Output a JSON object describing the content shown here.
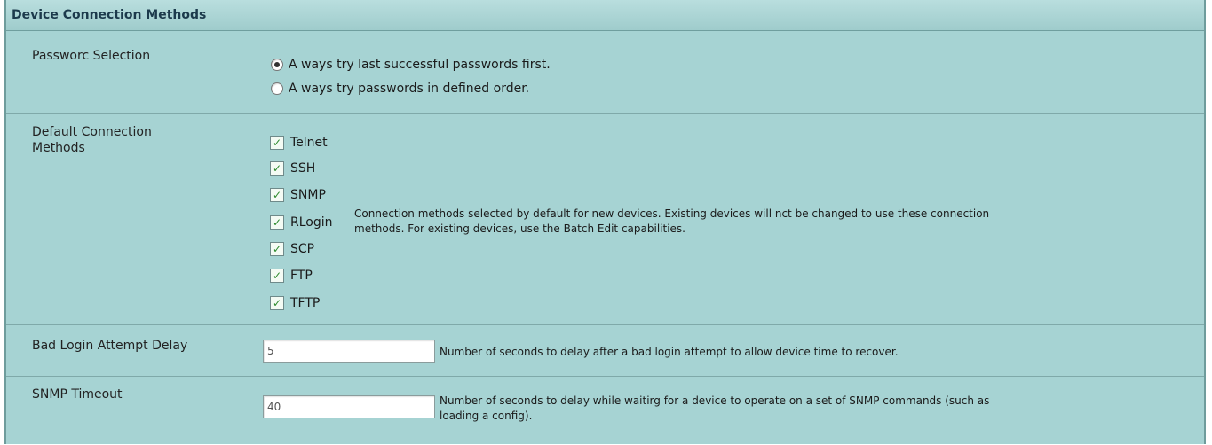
{
  "panel": {
    "title": "Device Connection Methods"
  },
  "password_selection": {
    "label": "Passworc Selection",
    "options": [
      {
        "label": "A ways try last successful passwords first.",
        "selected": true
      },
      {
        "label": "A ways try passwords in defined order.",
        "selected": false
      }
    ]
  },
  "connection_methods": {
    "label_line1": "Default Connection",
    "label_line2": "Methods",
    "methods": [
      {
        "label": "Telnet",
        "checked": true
      },
      {
        "label": "SSH",
        "checked": true
      },
      {
        "label": "SNMP",
        "checked": true
      },
      {
        "label": "RLogin",
        "checked": true
      },
      {
        "label": "SCP",
        "checked": true
      },
      {
        "label": "FTP",
        "checked": true
      },
      {
        "label": "TFTP",
        "checked": true
      }
    ],
    "description_line1": "Connection methods selected by default for new devices. Existing devices will nct be changed to use these connection",
    "description_line2": "methods. For existing devices, use the Batch Edit capabilities."
  },
  "bad_login_delay": {
    "label": "Bad Login Attempt Delay",
    "value": "5",
    "description": "Number of seconds to delay after a bad login attempt to allow device time to recover."
  },
  "snmp_timeout": {
    "label": "SNMP Timeout",
    "value": "40",
    "description_line1": "Number of seconds to delay while waitirg for a device to operate on a set of SNMP commands (such as",
    "description_line2": "loading a config)."
  },
  "colors": {
    "panel_bg": "#a6d3d3",
    "title_text": "#1c3a4c",
    "check_color": "#2c8a2c"
  }
}
